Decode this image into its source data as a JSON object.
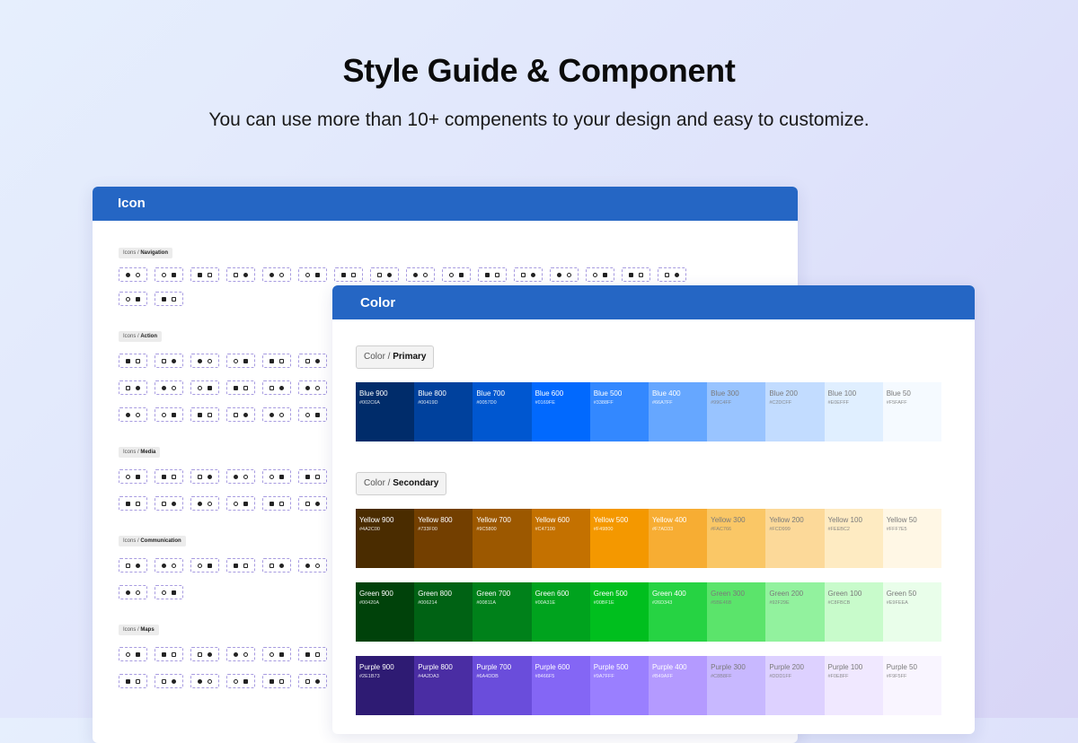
{
  "title": "Style Guide & Component",
  "subtitle": "You can use more than 10+ compenents to your design and easy to customize.",
  "icon_panel": {
    "header": "Icon",
    "groups": [
      {
        "prefix": "Icons / ",
        "name": "Navigation"
      },
      {
        "prefix": "Icons / ",
        "name": "Action"
      },
      {
        "prefix": "Icons / ",
        "name": "Media"
      },
      {
        "prefix": "Icons / ",
        "name": "Communication"
      },
      {
        "prefix": "Icons / ",
        "name": "Maps"
      }
    ]
  },
  "color_panel": {
    "header": "Color",
    "primary_label": {
      "prefix": "Color / ",
      "name": "Primary"
    },
    "secondary_label": {
      "prefix": "Color / ",
      "name": "Secondary"
    },
    "blue": [
      {
        "name": "Blue 900",
        "hex": "#002C6A"
      },
      {
        "name": "Blue 800",
        "hex": "#00419D"
      },
      {
        "name": "Blue 700",
        "hex": "#0057D0"
      },
      {
        "name": "Blue 600",
        "hex": "#0169FE"
      },
      {
        "name": "Blue 500",
        "hex": "#3388FF"
      },
      {
        "name": "Blue 400",
        "hex": "#66A7FF"
      },
      {
        "name": "Blue 300",
        "hex": "#99C4FF"
      },
      {
        "name": "Blue 200",
        "hex": "#C2DCFF"
      },
      {
        "name": "Blue 100",
        "hex": "#E0EFFF"
      },
      {
        "name": "Blue 50",
        "hex": "#F5FAFF"
      }
    ],
    "yellow": [
      {
        "name": "Yellow 900",
        "hex": "#4A2C00"
      },
      {
        "name": "Yellow 800",
        "hex": "#733F00"
      },
      {
        "name": "Yellow 700",
        "hex": "#9C5800"
      },
      {
        "name": "Yellow 600",
        "hex": "#C47100"
      },
      {
        "name": "Yellow 500",
        "hex": "#F49800"
      },
      {
        "name": "Yellow 400",
        "hex": "#F7AD33"
      },
      {
        "name": "Yellow 300",
        "hex": "#FAC766"
      },
      {
        "name": "Yellow 200",
        "hex": "#FCD999"
      },
      {
        "name": "Yellow 100",
        "hex": "#FEEBC2"
      },
      {
        "name": "Yellow 50",
        "hex": "#FFF7E5"
      }
    ],
    "green": [
      {
        "name": "Green 900",
        "hex": "#00420A"
      },
      {
        "name": "Green 800",
        "hex": "#006214"
      },
      {
        "name": "Green 700",
        "hex": "#00811A"
      },
      {
        "name": "Green 600",
        "hex": "#00A31E"
      },
      {
        "name": "Green 500",
        "hex": "#00BF1E"
      },
      {
        "name": "Green 400",
        "hex": "#26D343"
      },
      {
        "name": "Green 300",
        "hex": "#5BE46B"
      },
      {
        "name": "Green 200",
        "hex": "#92F29E"
      },
      {
        "name": "Green 100",
        "hex": "#C8FBCB"
      },
      {
        "name": "Green 50",
        "hex": "#E9FEEA"
      }
    ],
    "purple": [
      {
        "name": "Purple 900",
        "hex": "#2E1B73"
      },
      {
        "name": "Purple 800",
        "hex": "#4A2DA3"
      },
      {
        "name": "Purple 700",
        "hex": "#6A4DDB"
      },
      {
        "name": "Purple 600",
        "hex": "#8466F5"
      },
      {
        "name": "Purple 500",
        "hex": "#9A7FFF"
      },
      {
        "name": "Purple 400",
        "hex": "#B49AFF"
      },
      {
        "name": "Purple 300",
        "hex": "#C8B8FF"
      },
      {
        "name": "Purple 200",
        "hex": "#DDD1FF"
      },
      {
        "name": "Purple 100",
        "hex": "#F0E8FF"
      },
      {
        "name": "Purple 50",
        "hex": "#F9F5FF"
      }
    ]
  }
}
